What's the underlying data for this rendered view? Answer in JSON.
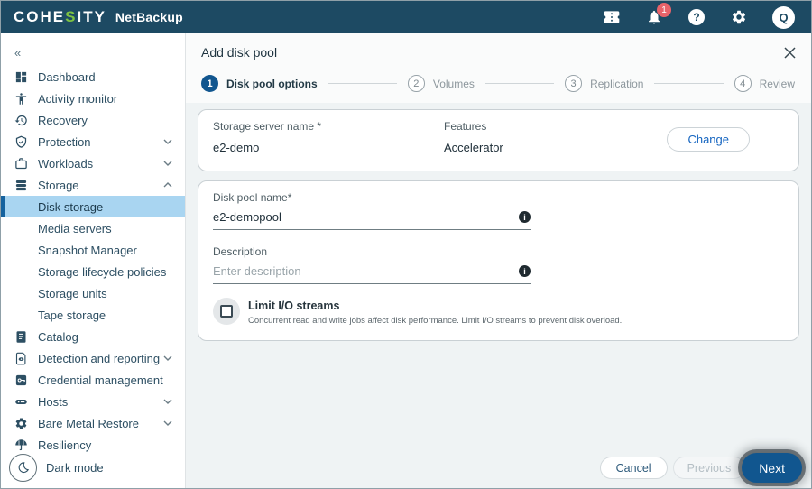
{
  "topbar": {
    "brand": {
      "pre": "COHE",
      "s": "S",
      "post": "ITY",
      "product": "NetBackup"
    },
    "notifications": {
      "count": "1"
    },
    "help_glyph": "?",
    "avatar_initial": "Q",
    "icons": [
      "license-ticket-icon",
      "notifications-bell-icon",
      "help-icon",
      "settings-gear-icon",
      "user-avatar"
    ]
  },
  "sidebar": {
    "collapse_glyph": "«",
    "items": [
      {
        "label": "Dashboard",
        "icon": "dashboard-icon"
      },
      {
        "label": "Activity monitor",
        "icon": "activity-monitor-icon"
      },
      {
        "label": "Recovery",
        "icon": "recovery-icon"
      },
      {
        "label": "Protection",
        "icon": "protection-shield-icon",
        "chevron": "down"
      },
      {
        "label": "Workloads",
        "icon": "workloads-briefcase-icon",
        "chevron": "down"
      },
      {
        "label": "Storage",
        "icon": "storage-disks-icon",
        "chevron": "up",
        "expanded": true
      },
      {
        "label": "Catalog",
        "icon": "catalog-book-icon"
      },
      {
        "label": "Detection and reporting",
        "icon": "detection-report-icon",
        "chevron": "down"
      },
      {
        "label": "Credential management",
        "icon": "credential-key-icon"
      },
      {
        "label": "Hosts",
        "icon": "hosts-server-icon",
        "chevron": "down"
      },
      {
        "label": "Bare Metal Restore",
        "icon": "bare-metal-gear-icon",
        "chevron": "down"
      },
      {
        "label": "Resiliency",
        "icon": "resiliency-umbrella-icon"
      }
    ],
    "storage_children": [
      {
        "label": "Disk storage",
        "selected": true
      },
      {
        "label": "Media servers"
      },
      {
        "label": "Snapshot Manager"
      },
      {
        "label": "Storage lifecycle policies"
      },
      {
        "label": "Storage units"
      },
      {
        "label": "Tape storage"
      }
    ],
    "dark_mode_label": "Dark mode"
  },
  "wizard": {
    "title": "Add disk pool",
    "steps": [
      {
        "number": "1",
        "label": "Disk pool options",
        "state": "active"
      },
      {
        "number": "2",
        "label": "Volumes",
        "state": "inactive"
      },
      {
        "number": "3",
        "label": "Replication",
        "state": "inactive"
      },
      {
        "number": "4",
        "label": "Review",
        "state": "inactive"
      }
    ],
    "server_card": {
      "name_label": "Storage server name *",
      "name_value": "e2-demo",
      "features_label": "Features",
      "features_value": "Accelerator",
      "change_button": "Change"
    },
    "form_card": {
      "pool_name_label": "Disk pool name*",
      "pool_name_value": "e2-demopool",
      "description_label": "Description",
      "description_placeholder": "Enter description",
      "info_glyph": "i",
      "limit_streams_label": "Limit I/O streams",
      "limit_streams_help": "Concurrent read and write jobs affect disk performance. Limit I/O streams to prevent disk overload.",
      "limit_streams_checked": false
    },
    "footer": {
      "cancel": "Cancel",
      "previous": "Previous",
      "next": "Next"
    }
  },
  "colors": {
    "topbar_bg": "#1d4a63",
    "brand_green": "#7dc242",
    "badge_red": "#e8636a",
    "accent_blue": "#11568f",
    "selected_item_bg": "#a9d5f1",
    "selected_item_border": "#15629e",
    "link_blue": "#1565c0",
    "main_bg": "#eff3f4"
  }
}
